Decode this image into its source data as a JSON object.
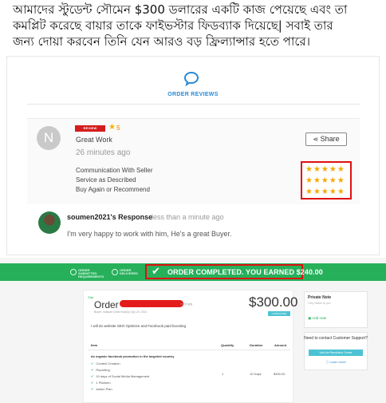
{
  "caption": {
    "line1": "আমাদের স্টুডেন্ট সৌমেন  $300 ডলারের একটি কাজ পেয়েছে  এবং তা",
    "line2": "কমপ্লিট করেছে বায়ার তাকে  ফাইভস্টার ফিডব্যাক দিয়েছে| সবাই তার",
    "line3": "জন্য দোয়া করবেন তিনি যেন আরও বড় ফ্রিল্যান্সার হতে পারে।"
  },
  "reviews": {
    "title": "ORDER REVIEWS",
    "buyer_initial": "N",
    "badge_text": "REVIEW RESULTS",
    "badge_rating": "5",
    "review_text": "Great Work",
    "review_time": "26 minutes ago",
    "share_label": "Share",
    "criteria": [
      {
        "label": "Communication With Seller",
        "stars": 5
      },
      {
        "label": "Service as Described",
        "stars": 5
      },
      {
        "label": "Buy Again or Recommend",
        "stars": 5
      }
    ],
    "seller_response": "soumen2021's Response",
    "seller_time": "less than a minute ago",
    "seller_text": "I'm very happy to work with him, He's a great Buyer."
  },
  "order": {
    "banner_left_tabs": [
      "ORDER SUBMITTED REQUIREMENTS",
      "ORDER DELIVERED"
    ],
    "completed_text": "ORDER COMPLETED. YOU EARNED $240.00",
    "star_label": "Star",
    "title": "Order",
    "title_suffix": "mine.jpg",
    "meta": "Buyer: nickpan (view history)   July 20, 2021",
    "price": "$300.00",
    "status": "COMPLETED ORDER",
    "description": "I will do website SEO Optimize and Facebook paid boosting",
    "columns": [
      "Item",
      "Quantity",
      "Duration",
      "Amount"
    ],
    "item_name": "do organic facebook promotion in the targeted country",
    "features": [
      "Content Creation",
      "Reporting",
      "10 days of Social Media Management",
      "1 Platform",
      "Action Plan"
    ],
    "quantity": "1",
    "duration": "10 Days",
    "amount": "$300.00"
  },
  "sidebar": {
    "private_note_title": "Private Note",
    "private_note_sub": "Only visible to you",
    "add_note": "Add note",
    "support_title": "Need to contact Customer Support?",
    "support_button": "Visit the Resolution Center",
    "learn_more": "Learn more"
  },
  "colors": {
    "accent_green": "#26b05a",
    "highlight_red": "#e01010",
    "star_gold": "#f5a800",
    "link_blue": "#2a8ad4"
  }
}
